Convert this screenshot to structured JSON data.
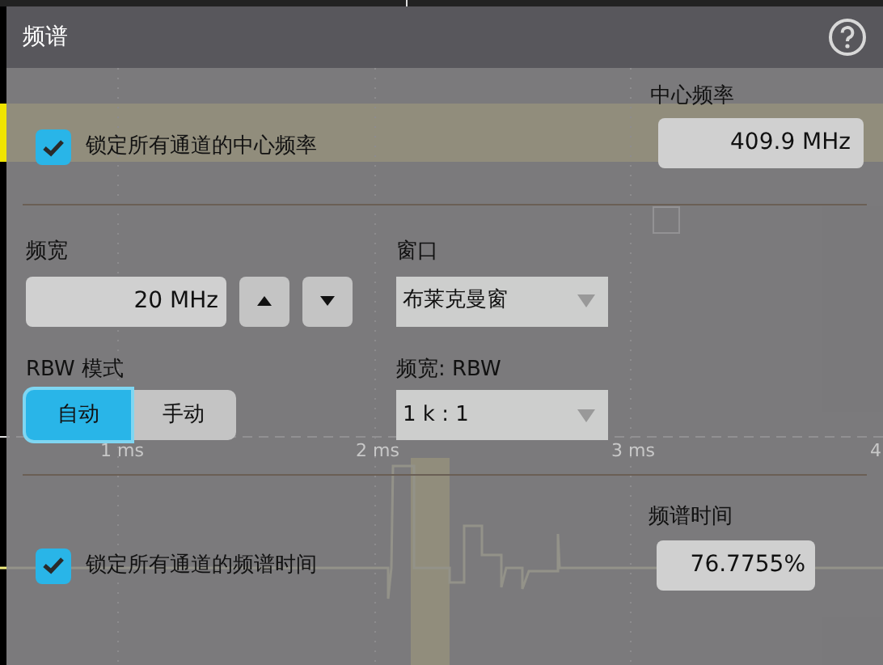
{
  "dialog": {
    "title": "频谱"
  },
  "lock_center": {
    "label": "锁定所有通道的中心频率",
    "checked": true
  },
  "center_frequency": {
    "label": "中心频率",
    "value": "409.9 MHz"
  },
  "span": {
    "label": "频宽",
    "value": "20 MHz"
  },
  "window": {
    "label": "窗口",
    "value": "布莱克曼窗"
  },
  "rbw_mode": {
    "label": "RBW 模式",
    "options": [
      {
        "label": "自动",
        "selected": true
      },
      {
        "label": "手动",
        "selected": false
      }
    ]
  },
  "span_rbw": {
    "label": "频宽: RBW",
    "value": "1 k : 1"
  },
  "lock_time": {
    "label": "锁定所有通道的频谱时间",
    "checked": true
  },
  "spectrum_time": {
    "label": "频谱时间",
    "value": "76.7755%"
  },
  "background": {
    "time_axis_labels": [
      "1 ms",
      "2 ms",
      "3 ms",
      "4"
    ]
  }
}
